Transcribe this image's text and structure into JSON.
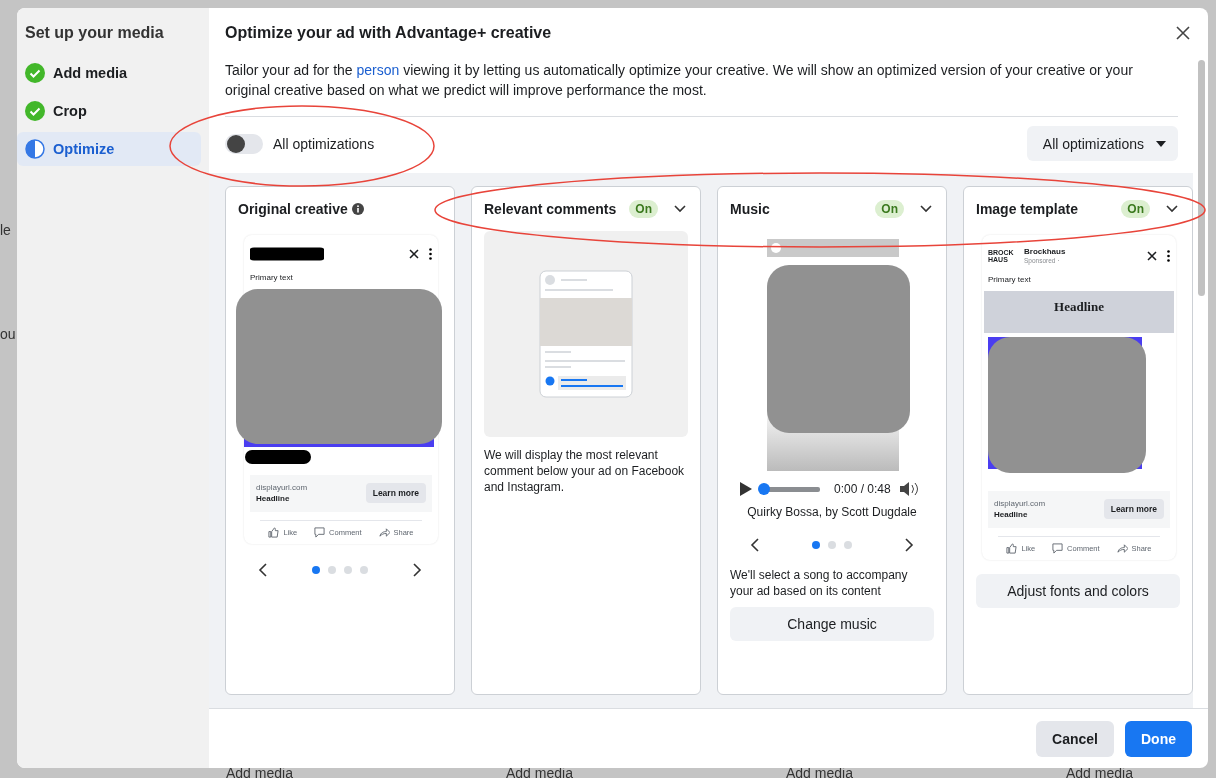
{
  "backdrop": {
    "left_fragments": [
      "le",
      "ou"
    ],
    "bottom_labels": [
      "Add media",
      "Add media",
      "Add media",
      "Add media"
    ]
  },
  "sidebar": {
    "title": "Set up your media",
    "steps": [
      {
        "label": "Add media",
        "completed": true,
        "selected": false
      },
      {
        "label": "Crop",
        "completed": true,
        "selected": false
      },
      {
        "label": "Optimize",
        "completed": false,
        "selected": true
      }
    ]
  },
  "header": {
    "title": "Optimize your ad with Advantage+ creative"
  },
  "description": {
    "before": "Tailor your ad for the",
    "link": "person",
    "after": "viewing it by letting us automatically optimize your creative. We will show an optimized version of your creative or your original creative based on what we predict will improve performance the most."
  },
  "master_toggle": {
    "label": "All optimizations",
    "on": false
  },
  "filter_dropdown": {
    "label": "All optimizations"
  },
  "cards": [
    {
      "kind": "original",
      "title": "Original creative",
      "info": true,
      "preview": {
        "primary_text": "Primary text",
        "url": "displayurl.com",
        "headline": "Headline",
        "cta": "Learn more",
        "actions": [
          "Like",
          "Comment",
          "Share"
        ]
      },
      "pager": [
        {
          "selected": true
        },
        {
          "selected": false
        },
        {
          "selected": false
        },
        {
          "selected": false
        }
      ]
    },
    {
      "kind": "comments",
      "title": "Relevant comments",
      "badge": "On",
      "description": "We will display the most relevant comment below your ad on Facebook and Instagram."
    },
    {
      "kind": "music",
      "title": "Music",
      "badge": "On",
      "player": {
        "time": "0:00 / 0:48",
        "level": 0
      },
      "track": "Quirky Bossa, by Scott Dugdale",
      "pager": [
        {
          "selected": true
        },
        {
          "selected": false
        },
        {
          "selected": false
        }
      ],
      "description": "We'll select a song to accompany your ad based on its content",
      "button": "Change music"
    },
    {
      "kind": "template",
      "title": "Image template",
      "badge": "On",
      "preview": {
        "logo": "BROCK HAUS",
        "brand": "Brockhaus",
        "sponsored": "Sponsored ·",
        "primary_text": "Primary text",
        "overlay_headline": "Headline",
        "url": "displayurl.com",
        "headline": "Headline",
        "cta": "Learn more",
        "actions": [
          "Like",
          "Comment",
          "Share"
        ]
      },
      "button": "Adjust fonts and colors"
    }
  ],
  "footer": {
    "buttons": [
      {
        "label": "Cancel",
        "kind": "secondary"
      },
      {
        "label": "Done",
        "kind": "primary"
      }
    ]
  }
}
